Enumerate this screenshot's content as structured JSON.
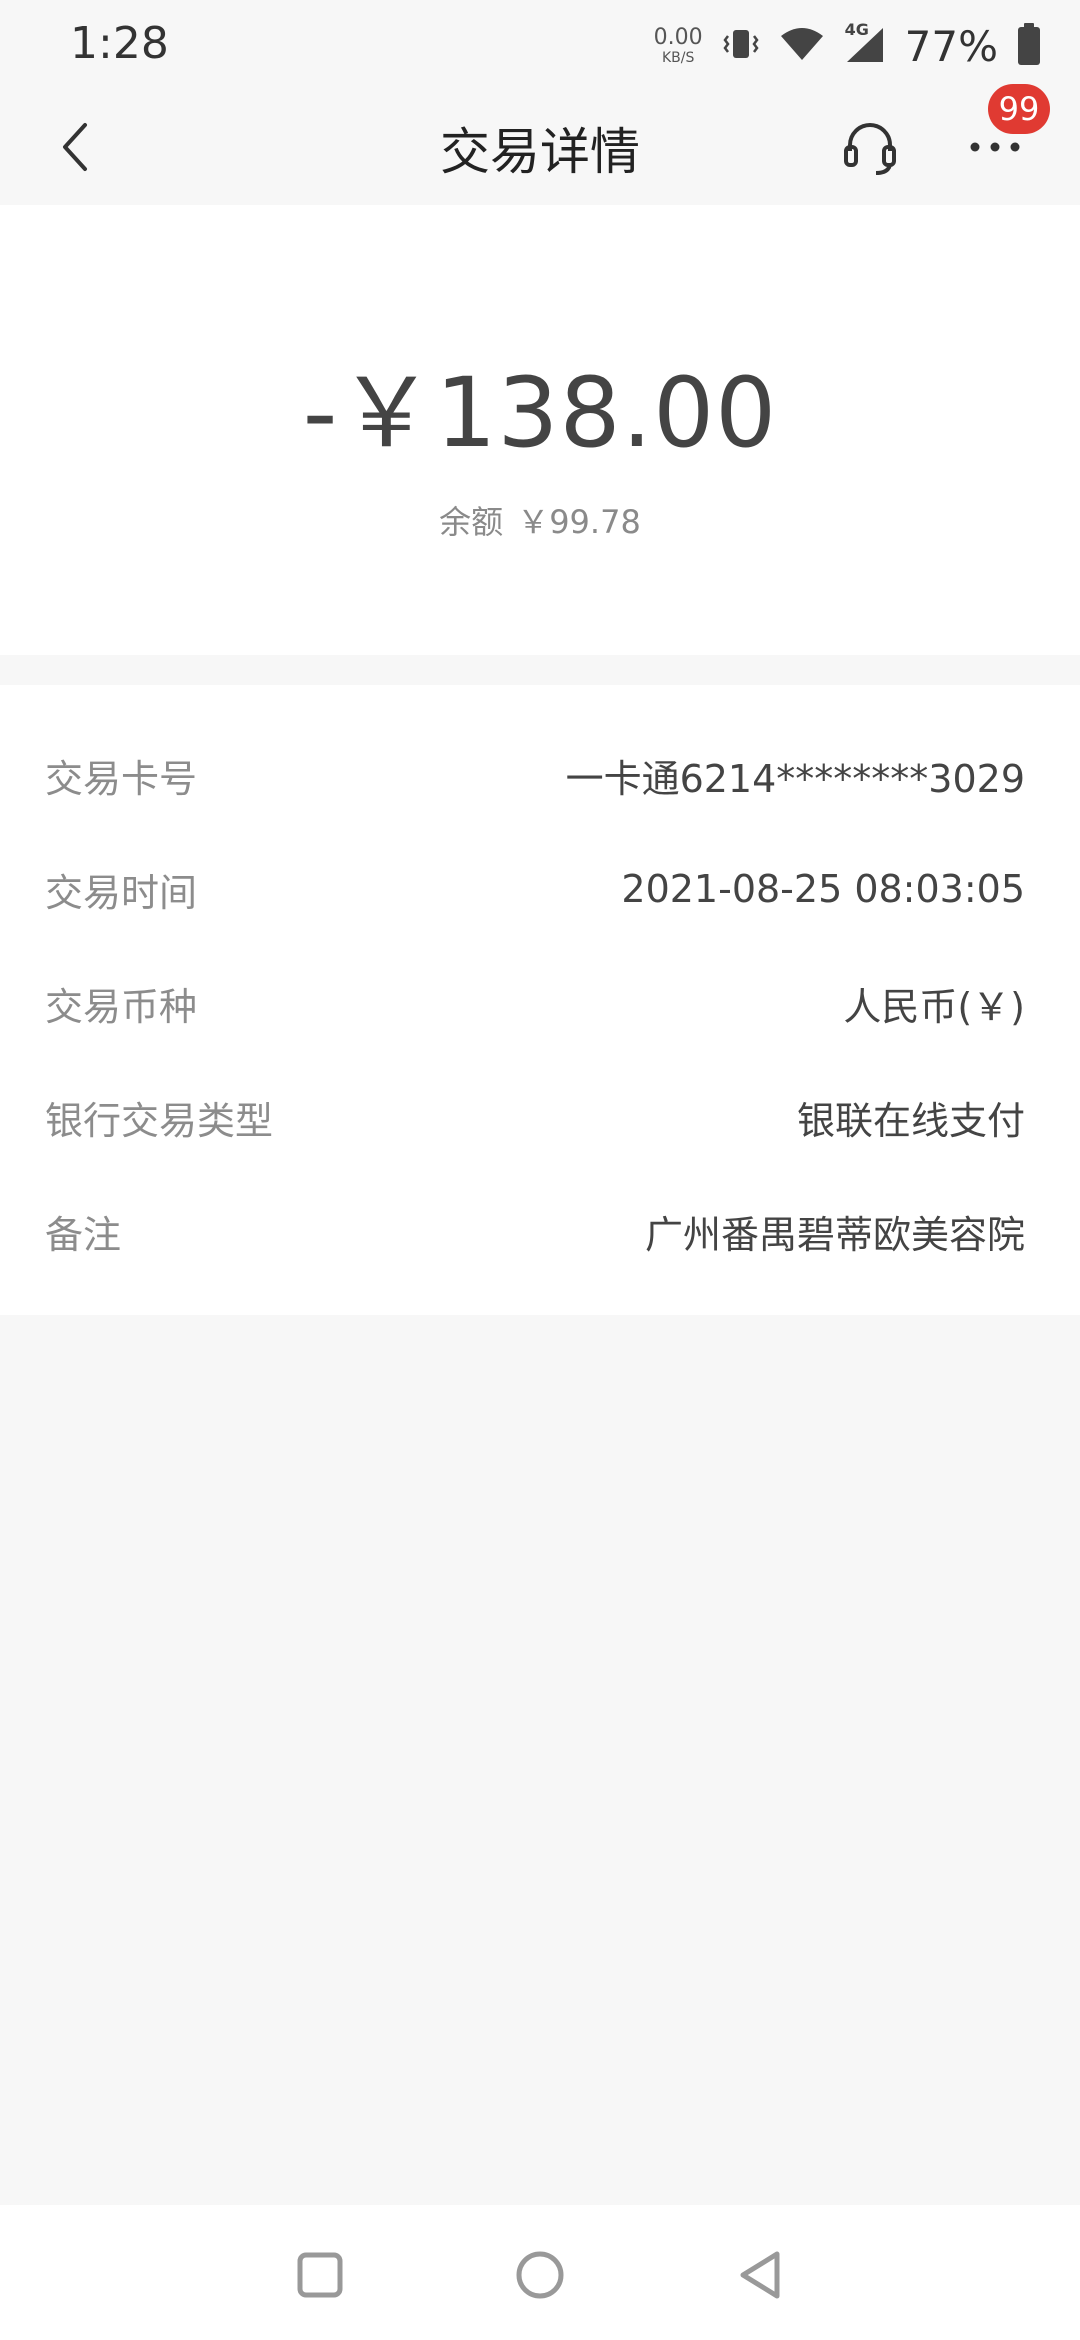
{
  "status_bar": {
    "time": "1:28",
    "net_speed_value": "0.00",
    "net_speed_unit": "KB/S",
    "network_type": "4G",
    "battery_percent": "77%",
    "icons": [
      "vibrate-icon",
      "wifi-icon",
      "cellular-signal-icon",
      "battery-icon"
    ]
  },
  "header": {
    "title": "交易详情",
    "back_icon": "chevron-left-icon",
    "support_icon": "headset-icon",
    "more_icon": "more-dots-icon",
    "badge_count": "99"
  },
  "summary": {
    "amount": "-￥138.00",
    "balance_label": "余额",
    "balance_value": "￥99.78"
  },
  "details": [
    {
      "label": "交易卡号",
      "value": "一卡通6214********3029"
    },
    {
      "label": "交易时间",
      "value": "2021-08-25 08:03:05"
    },
    {
      "label": "交易币种",
      "value": "人民币(￥)"
    },
    {
      "label": "银行交易类型",
      "value": "银联在线支付"
    },
    {
      "label": "备注",
      "value": "广州番禺碧蒂欧美容院"
    }
  ],
  "system_nav": {
    "icons": [
      "recent-apps-icon",
      "home-icon",
      "back-triangle-icon"
    ]
  },
  "colors": {
    "background": "#f7f7f7",
    "card": "#ffffff",
    "badge": "#e03a32",
    "label_text": "#8c8c8c",
    "value_text": "#444444"
  }
}
